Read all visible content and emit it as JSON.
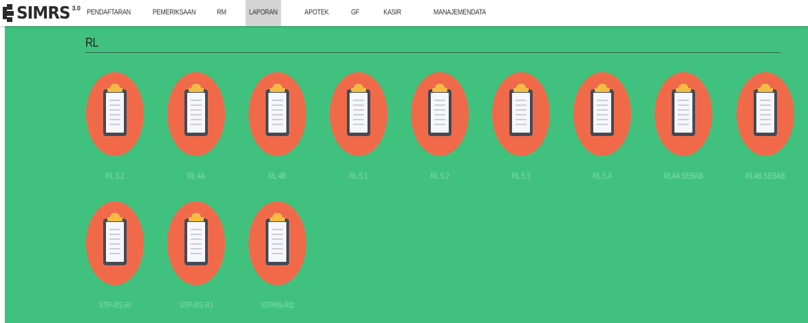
{
  "app": {
    "logo_text": "SIMRS",
    "logo_version": "3.0"
  },
  "nav": {
    "items": [
      {
        "label": "PENDAFTARAN"
      },
      {
        "label": "PEMERIKSAAN"
      },
      {
        "label": "RM"
      },
      {
        "label": "LAPORAN",
        "active": true
      },
      {
        "label": "APOTEK"
      },
      {
        "label": "GF"
      },
      {
        "label": "KASIR"
      },
      {
        "label": "MANAJEMENDATA"
      }
    ]
  },
  "section": {
    "title": "RL"
  },
  "reports": {
    "icon": "clipboard-icon",
    "items": [
      {
        "label": "RL 3.2"
      },
      {
        "label": "RL 4A"
      },
      {
        "label": "RL 4B"
      },
      {
        "label": "RL 5.1"
      },
      {
        "label": "RL 5.2"
      },
      {
        "label": "RL 5.3"
      },
      {
        "label": "RL 5.4"
      },
      {
        "label": "RL4A SEBAB"
      },
      {
        "label": "RL4B SEBAB"
      },
      {
        "label": "STP-RS-RI"
      },
      {
        "label": "STP-RS-RJ"
      },
      {
        "label": "STPRS-RI2"
      }
    ]
  },
  "colors": {
    "background": "#40c27e",
    "icon_circle": "#f06a4a",
    "clip": "#f6bb42",
    "board": "#434a54",
    "label": "#86d9ad"
  }
}
